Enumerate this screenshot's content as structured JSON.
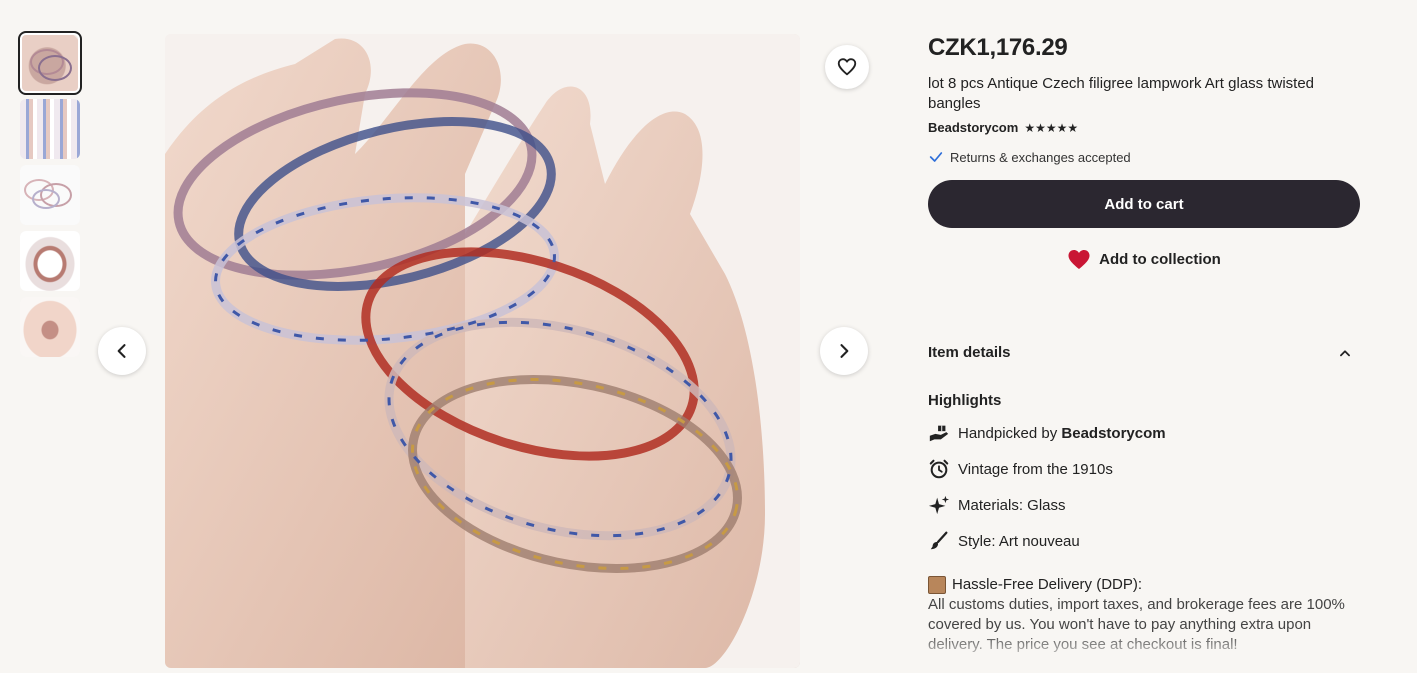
{
  "listing": {
    "price": "CZK1,176.29",
    "title": "lot 8 pcs Antique Czech filigree lampwork Art glass twisted bangles",
    "shop_name": "Beadstorycom",
    "rating_stars": "★★★★★",
    "rating": 5,
    "returns_text": "Returns & exchanges accepted"
  },
  "actions": {
    "add_to_cart": "Add to cart",
    "add_to_collection": "Add to collection"
  },
  "item_details": {
    "header": "Item details",
    "highlights_title": "Highlights",
    "highlights": [
      {
        "icon": "hand-gift-icon",
        "prefix": "Handpicked by ",
        "bold": "Beadstorycom"
      },
      {
        "icon": "alarm-clock-icon",
        "text": "Vintage from the 1910s"
      },
      {
        "icon": "sparkle-icon",
        "text": "Materials: Glass"
      },
      {
        "icon": "paintbrush-icon",
        "text": "Style: Art nouveau"
      }
    ],
    "ddp_title": "Hassle-Free Delivery (DDP):",
    "ddp_text": "All customs duties, import taxes, and brokerage fees are 100% covered by us. You won't have to pay anything extra upon delivery. The price you see at checkout is final!"
  },
  "gallery": {
    "thumbnail_count": 5,
    "active_index": 0
  },
  "colors": {
    "background": "#f8f6f3",
    "cart_button": "#2b2730",
    "heart": "#c91634",
    "check": "#2f6fd9"
  }
}
